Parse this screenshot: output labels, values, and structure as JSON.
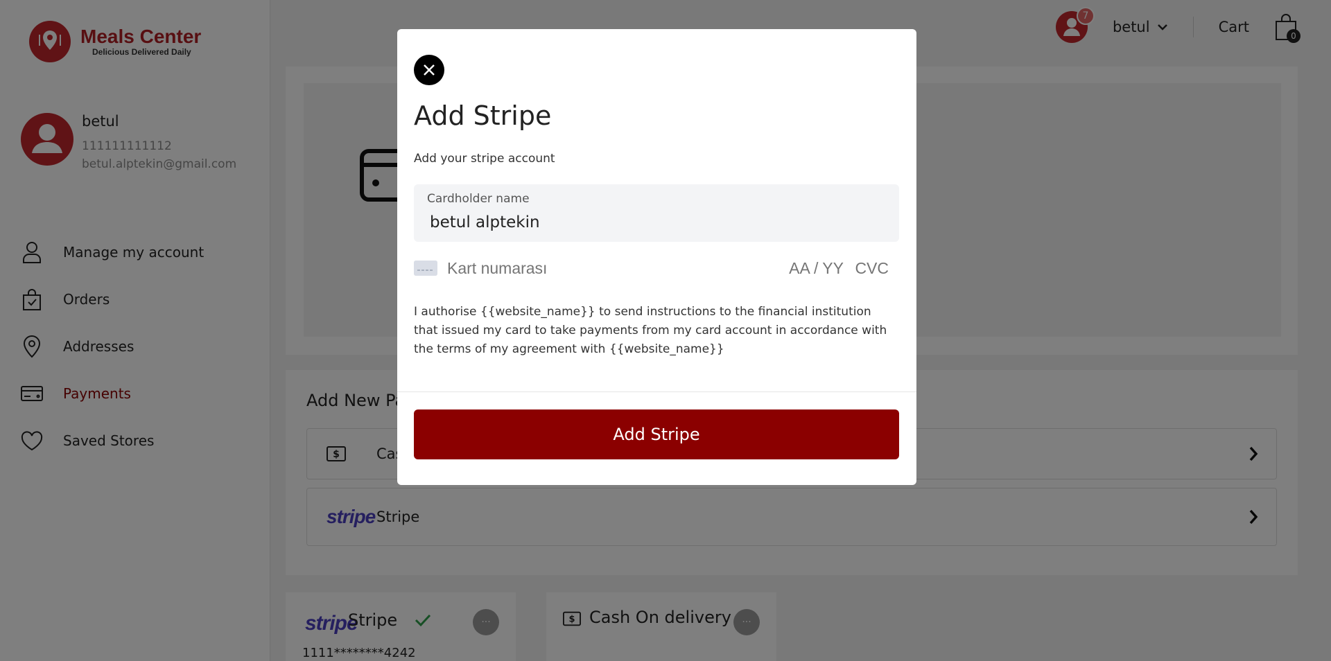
{
  "brand": {
    "name": "Meals Center",
    "tagline": "Delicious Delivered Daily",
    "accent": "#c0262d",
    "primary": "#8b0000"
  },
  "profile": {
    "name": "betul",
    "phone": "111111111112",
    "email": "betul.alptekin@gmail.com"
  },
  "sidebar": {
    "items": [
      {
        "label": "Manage my account",
        "icon": "user-icon"
      },
      {
        "label": "Orders",
        "icon": "shopping-bag-icon"
      },
      {
        "label": "Addresses",
        "icon": "location-pin-icon"
      },
      {
        "label": "Payments",
        "icon": "credit-card-icon",
        "active": true
      },
      {
        "label": "Saved Stores",
        "icon": "heart-icon"
      }
    ]
  },
  "header": {
    "notification_count": "7",
    "username": "betul",
    "cart_label": "Cart",
    "cart_count": "0"
  },
  "main": {
    "add_new_title": "Add New Pa",
    "methods": [
      {
        "label": "Cas",
        "icon": "cash-icon"
      },
      {
        "label": "Stripe",
        "icon": "stripe-logo"
      }
    ],
    "saved": [
      {
        "title": "Stripe",
        "logo": "stripe",
        "verified": true,
        "number": "1111********4242"
      },
      {
        "title": "Cash On delivery",
        "icon": "cash-icon"
      }
    ],
    "dots": "···"
  },
  "modal": {
    "title": "Add Stripe",
    "subtitle": "Add your stripe account",
    "cardholder_label": "Cardholder name",
    "cardholder_value": "betul alptekin",
    "card_number_placeholder": "Kart numarası",
    "expiry_placeholder": "AA / YY",
    "cvc_placeholder": "CVC",
    "mandate": "I authorise {{website_name}} to send instructions to the financial institution that issued my card to take payments from my card account in accordance with the terms of my agreement with {{website_name}}",
    "submit_label": "Add Stripe"
  }
}
